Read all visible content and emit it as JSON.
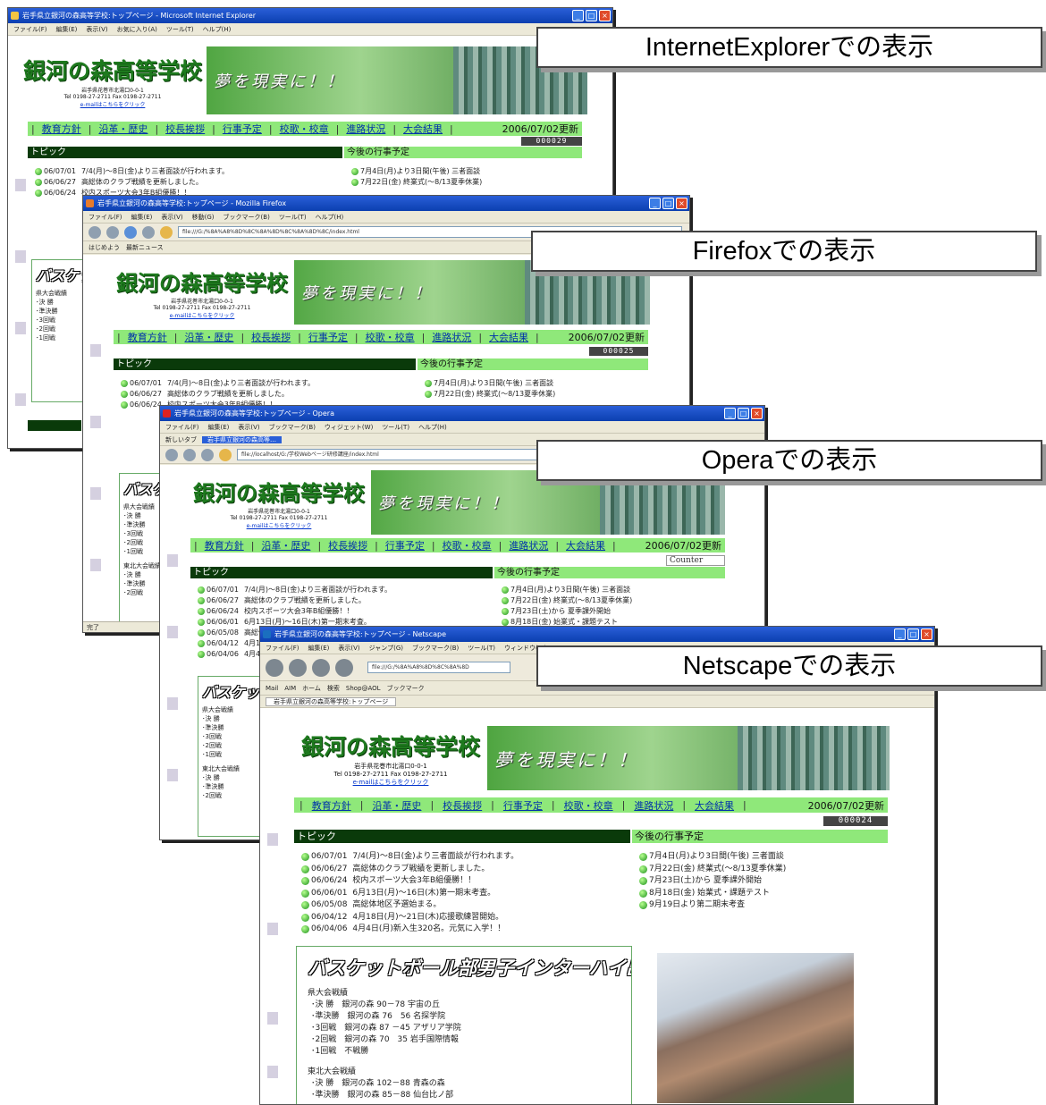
{
  "labels": [
    "InternetExplorerでの表示",
    "Firefoxでの表示",
    "Operaでの表示",
    "Netscapeでの表示"
  ],
  "site": {
    "title": "銀河の森高等学校",
    "slogan": "夢を現実に！！",
    "address": "岩手県花巻市北湯口0-0-1",
    "tel": "Tel 0198-27-2711 Fax 0198-27-2711",
    "email": "e-mailはこちらをクリック",
    "nav": [
      "教育方針",
      "沿革・歴史",
      "校長挨拶",
      "行事予定",
      "校歌・校章",
      "進路状況",
      "大会結果"
    ],
    "updated": "2006/07/02更新",
    "topics_header": "トピック",
    "schedule_header": "今後の行事予定",
    "topics": [
      {
        "date": "06/07/01",
        "text": "7/4(月)～8日(金)より三者面談が行われます。"
      },
      {
        "date": "06/06/27",
        "text": "高総体のクラブ戦績を更新しました。"
      },
      {
        "date": "06/06/24",
        "text": "校内スポーツ大会3年B組優勝！！"
      },
      {
        "date": "06/06/01",
        "text": "6月13日(月)～16日(木)第一期末考査。"
      },
      {
        "date": "06/05/08",
        "text": "高総体地区予選始まる。"
      },
      {
        "date": "06/04/12",
        "text": "4月18日(月)～21日(木)応援歌練習開始。"
      },
      {
        "date": "06/04/06",
        "text": "4月4日(月)新入生320名。元気に入学！！"
      }
    ],
    "schedule": [
      "7月4日(月)より3日間(午後) 三者面談",
      "7月22日(金) 終業式(～8/13夏季休業)",
      "7月23日(土)から 夏季課外開始",
      "8月18日(金) 始業式・課題テスト",
      "9月19日より第二期末考査"
    ],
    "box_title": "バスケットボール部男子インターハイ出場",
    "box_lines": [
      "県大会戦績",
      "･決 勝　銀河の森 90－78 宇宙の丘",
      "･準決勝　銀河の森 76　56 名探学院",
      "･3回戦　銀河の森 87 －45 アザリア学院",
      "･2回戦　銀河の森 70　35 岩手国際情報",
      "･1回戦　不戦勝",
      "",
      "東北大会戦績",
      "･決 勝　銀河の森 102－88 青森の森",
      "･準決勝　銀河の森 85－88 仙台比ノ部"
    ],
    "box_lines_short": [
      "県大会戦績",
      "･決 勝",
      "･準決勝",
      "･3回戦",
      "･2回戦",
      "･1回戦",
      "",
      "東北大会戦績",
      "･決 勝",
      "･準決勝",
      "･2回戦"
    ]
  },
  "ie": {
    "title": "岩手県立銀河の森高等学校:トップページ - Microsoft Internet Explorer",
    "menu": [
      "ファイル(F)",
      "編集(E)",
      "表示(V)",
      "お気に入り(A)",
      "ツール(T)",
      "ヘルプ(H)"
    ],
    "counter": "000029"
  },
  "ff": {
    "title": "岩手県立銀河の森高等学校:トップページ - Mozilla Firefox",
    "menu": [
      "ファイル(F)",
      "編集(E)",
      "表示(V)",
      "移動(G)",
      "ブックマーク(B)",
      "ツール(T)",
      "ヘルプ(H)"
    ],
    "address": "file:///G:/%8A%A8%8D%8C%8A%8D%8C%8A%8D%8C/index.html",
    "bookmarks": "はじめよう　最新ニュース",
    "counter": "000025",
    "status": "完了"
  },
  "op": {
    "title": "岩手県立銀河の森高等学校:トップページ - Opera",
    "menu": [
      "ファイル(F)",
      "編集(E)",
      "表示(V)",
      "ブックマーク(B)",
      "ウィジェット(W)",
      "ツール(T)",
      "ヘルプ(H)"
    ],
    "tabs": "新しいタブ",
    "active_tab": "岩手県立銀河の森高等…",
    "address": "file://localhost/G:/学校Webページ研修講座/index.html",
    "counter": "Counter"
  },
  "ns": {
    "title": "岩手県立銀河の森高等学校:トップページ - Netscape",
    "menu": [
      "ファイル(F)",
      "編集(E)",
      "表示(V)",
      "ジャンプ(G)",
      "ブックマーク(B)",
      "ツール(T)",
      "ウィンドウ(W)"
    ],
    "address": "file:///G:/%8A%A8%8D%8C%8A%8D",
    "links": "Mail　AIM　ホーム　検索　Shop@AOL　ブックマーク",
    "tab": "岩手県立銀河の森高等学校:トップページ",
    "counter": "000024"
  }
}
